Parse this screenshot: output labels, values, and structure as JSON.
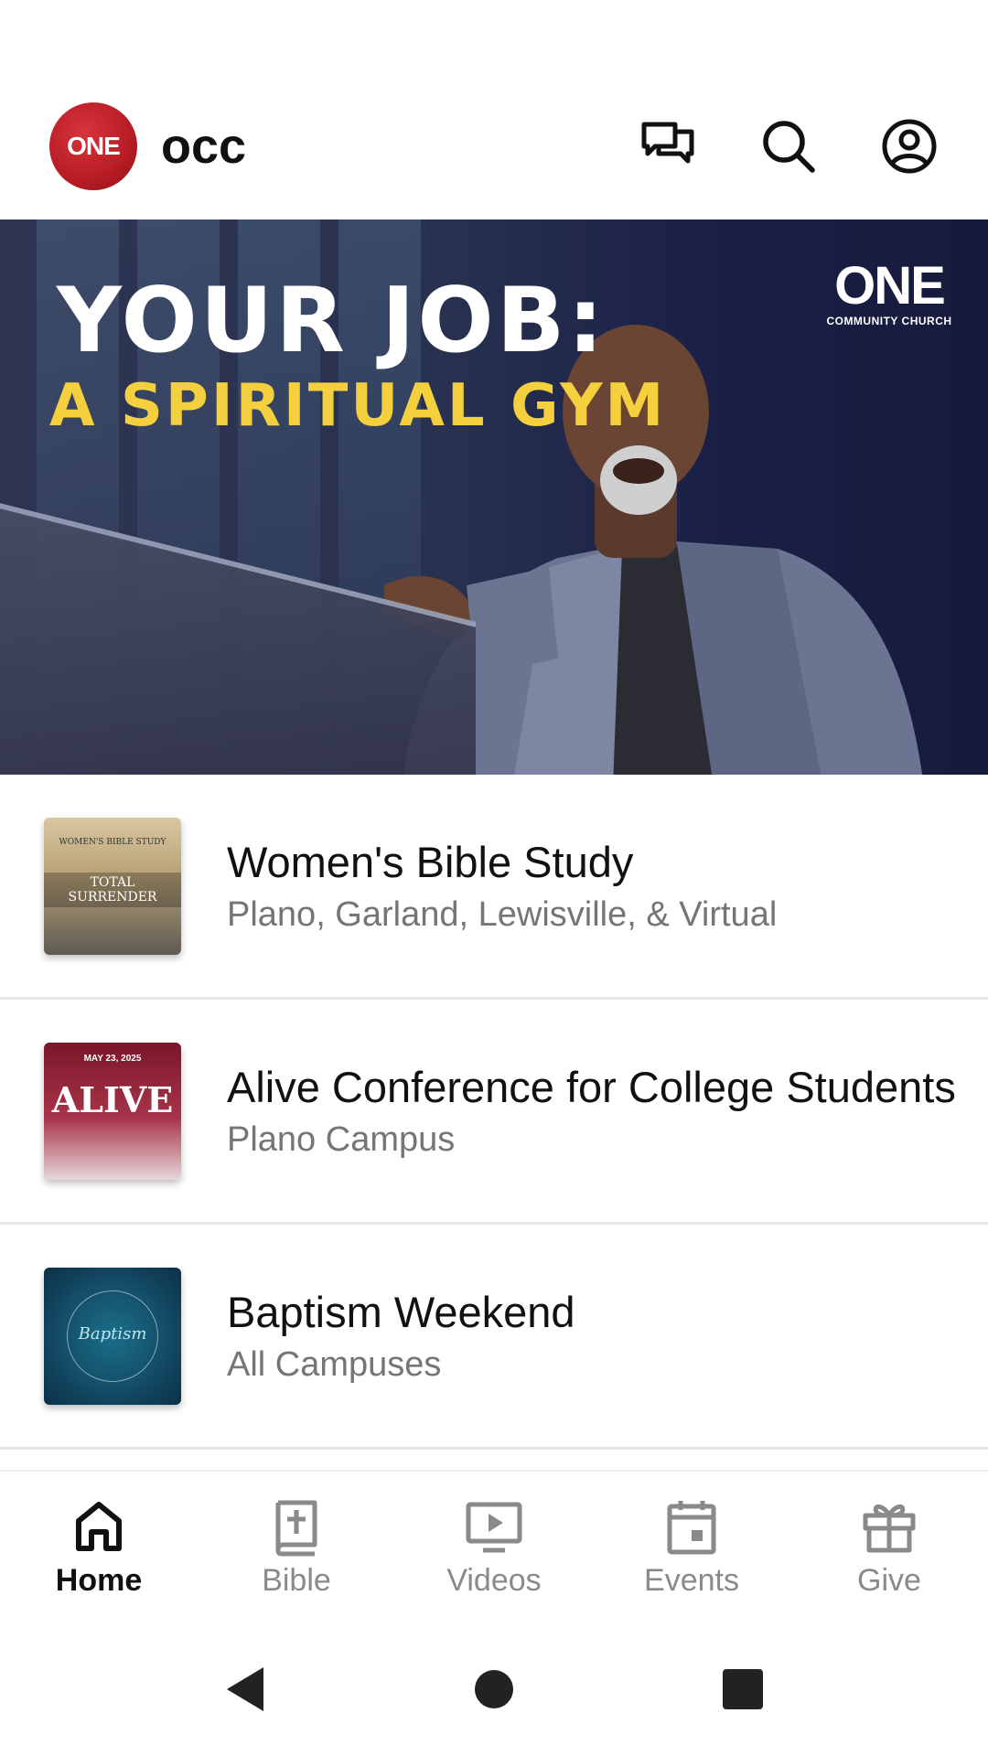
{
  "app": {
    "logo_text": "ONE",
    "title": "occ"
  },
  "header": {
    "actions": [
      "chat-icon",
      "search-icon",
      "account-icon"
    ]
  },
  "hero": {
    "title": "YOUR JOB:",
    "subtitle": "A SPIRITUAL GYM",
    "brand_main": "ONE",
    "brand_sub": "COMMUNITY CHURCH"
  },
  "list": {
    "items": [
      {
        "title": "Women's Bible Study",
        "subtitle": "Plano, Garland, Lewisville, & Virtual",
        "thumb_top": "WOMEN'S BIBLE STUDY",
        "thumb_main": "TOTAL SURRENDER"
      },
      {
        "title": "Alive Conference for College Students",
        "subtitle": "Plano Campus",
        "thumb_top": "MAY 23, 2025",
        "thumb_main": "ALIVE"
      },
      {
        "title": "Baptism Weekend",
        "subtitle": "All Campuses",
        "thumb_main": "Baptism"
      }
    ]
  },
  "bottom_nav": {
    "items": [
      {
        "label": "Home",
        "icon": "home-icon",
        "active": true
      },
      {
        "label": "Bible",
        "icon": "bible-icon",
        "active": false
      },
      {
        "label": "Videos",
        "icon": "video-icon",
        "active": false
      },
      {
        "label": "Events",
        "icon": "calendar-icon",
        "active": false
      },
      {
        "label": "Give",
        "icon": "gift-icon",
        "active": false
      }
    ]
  },
  "colors": {
    "brand_red": "#b71c24",
    "hero_yellow": "#f4cf3e",
    "text_secondary": "#757575",
    "nav_inactive": "#8a8a8a"
  }
}
